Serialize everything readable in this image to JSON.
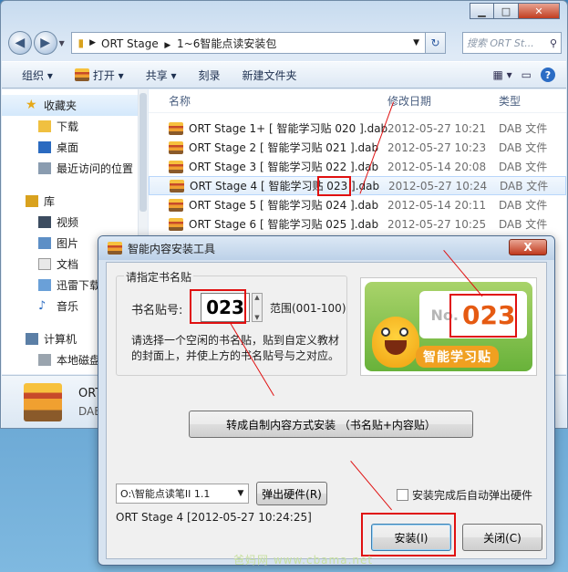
{
  "explorer": {
    "breadcrumb": [
      "ORT Stage",
      "1~6智能点读安装包"
    ],
    "search_placeholder": "搜索 ORT St...",
    "toolbar": {
      "organize": "组织 ▾",
      "open": "打开 ▾",
      "share": "共享 ▾",
      "burn": "刻录",
      "new_folder": "新建文件夹"
    },
    "nav": {
      "favorites": "收藏夹",
      "downloads": "下载",
      "desktop": "桌面",
      "recent": "最近访问的位置",
      "libraries": "库",
      "videos": "视频",
      "pictures": "图片",
      "documents": "文档",
      "xunlei": "迅雷下载",
      "music": "音乐",
      "computer": "计算机",
      "local_disk": "本地磁盘"
    },
    "columns": {
      "name": "名称",
      "date": "修改日期",
      "type": "类型"
    },
    "files": [
      {
        "name": "ORT Stage 1+ [ 智能学习贴 020 ].dab",
        "date": "2012-05-27 10:21",
        "type": "DAB 文件"
      },
      {
        "name": "ORT Stage 2 [ 智能学习贴 021 ].dab",
        "date": "2012-05-27 10:23",
        "type": "DAB 文件"
      },
      {
        "name": "ORT Stage 3 [ 智能学习贴 022 ].dab",
        "date": "2012-05-14 20:08",
        "type": "DAB 文件"
      },
      {
        "name": "ORT Stage 4 [ 智能学习贴 023 ].dab",
        "date": "2012-05-27 10:24",
        "type": "DAB 文件"
      },
      {
        "name": "ORT Stage 5 [ 智能学习贴 024 ].dab",
        "date": "2012-05-14 20:11",
        "type": "DAB 文件"
      },
      {
        "name": "ORT Stage 6 [ 智能学习贴 025 ].dab",
        "date": "2012-05-27 10:25",
        "type": "DAB 文件"
      }
    ],
    "details": {
      "name": "ORT",
      "type": "DAB"
    }
  },
  "dialog": {
    "title": "智能内容安装工具",
    "close": "X",
    "group_title": "请指定书名贴",
    "book_label": "书名贴号:",
    "book_value": "023",
    "range": "范围(001-100)",
    "hint": "请选择一个空闲的书名贴，贴到自定义教材的封面上，并使上方的书名贴号与之对应。",
    "sticker_no_prefix": "No.",
    "sticker_no_value": "023",
    "sticker_brand": "智能学习贴",
    "convert_button": "转成自制内容方式安装 （书名贴+内容贴）",
    "drive_value": "O:\\智能点读笔II  1.1",
    "eject_button": "弹出硬件(R)",
    "auto_eject_label": "安装完成后自动弹出硬件",
    "auto_eject_checked": false,
    "status": "ORT Stage 4 [2012-05-27 10:24:25]",
    "install_button": "安装(I)",
    "close_button": "关闭(C)"
  },
  "watermark": "爸妈网 www.cbama.net"
}
